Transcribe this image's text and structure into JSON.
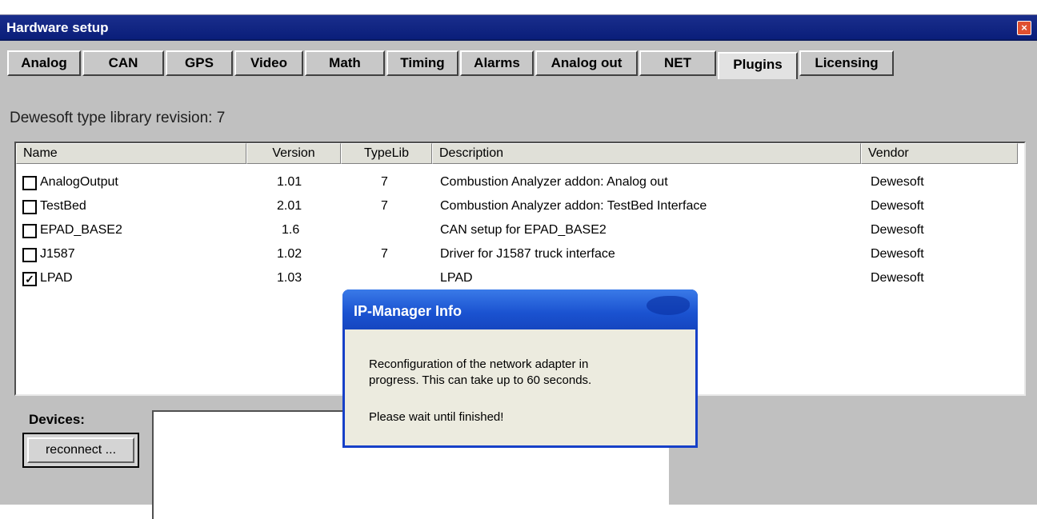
{
  "window": {
    "title": "Hardware setup",
    "close_symbol": "×"
  },
  "tabs": [
    {
      "label": "Analog",
      "active": false
    },
    {
      "label": "CAN",
      "active": false
    },
    {
      "label": "GPS",
      "active": false
    },
    {
      "label": "Video",
      "active": false
    },
    {
      "label": "Math",
      "active": false
    },
    {
      "label": "Timing",
      "active": false
    },
    {
      "label": "Alarms",
      "active": false
    },
    {
      "label": "Analog out",
      "active": false
    },
    {
      "label": "NET",
      "active": false
    },
    {
      "label": "Plugins",
      "active": true
    },
    {
      "label": "Licensing",
      "active": false
    }
  ],
  "revision": "Dewesoft type library revision:  7",
  "plugins": {
    "columns": [
      "Name",
      "Version",
      "TypeLib",
      "Description",
      "Vendor"
    ],
    "rows": [
      {
        "checked": false,
        "name": "AnalogOutput",
        "version": "1.01",
        "typelib": "7",
        "description": "Combustion Analyzer addon: Analog out",
        "vendor": "Dewesoft"
      },
      {
        "checked": false,
        "name": "TestBed",
        "version": "2.01",
        "typelib": "7",
        "description": "Combustion Analyzer addon: TestBed Interface",
        "vendor": "Dewesoft"
      },
      {
        "checked": false,
        "name": "EPAD_BASE2",
        "version": "1.6",
        "typelib": "",
        "description": "CAN setup for EPAD_BASE2",
        "vendor": "Dewesoft"
      },
      {
        "checked": false,
        "name": "J1587",
        "version": "1.02",
        "typelib": "7",
        "description": "Driver for J1587 truck interface",
        "vendor": "Dewesoft"
      },
      {
        "checked": true,
        "name": "LPAD",
        "version": "1.03",
        "typelib": "",
        "description": "LPAD",
        "vendor": "Dewesoft"
      }
    ]
  },
  "devices": {
    "label": "Devices:",
    "reconnect_label": "reconnect ..."
  },
  "dialog": {
    "title": "IP-Manager Info",
    "line1": "Reconfiguration of the network adapter in",
    "line2": "progress. This can take up to 60 seconds.",
    "line3": "Please wait until finished!"
  },
  "colors": {
    "title_bar": "#0a1e7a",
    "dialog_title": "#1a52d0",
    "face": "#c0c0c0"
  }
}
